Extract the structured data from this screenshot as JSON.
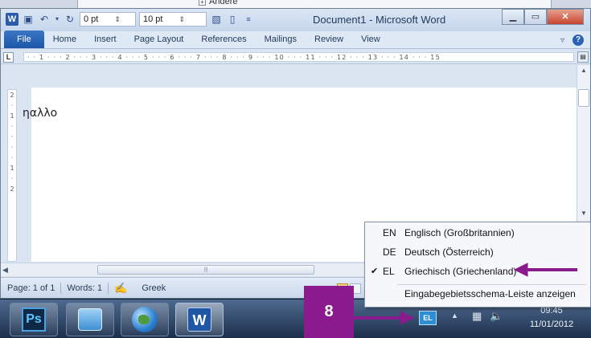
{
  "background_window": {
    "item_label": "Andere"
  },
  "titlebar": {
    "title": "Document1 - Microsoft Word",
    "app_icon": "W",
    "spacing_before": "0 pt",
    "spacing_after": "10 pt"
  },
  "ribbon_tabs": [
    "File",
    "Home",
    "Insert",
    "Page Layout",
    "References",
    "Mailings",
    "Review",
    "View"
  ],
  "ruler": {
    "corner": "L",
    "marks": "· · 1 · · · 2 · · · 3 · · · 4 · · · 5 · · · 6 · · · 7 · · · 8 · · · 9 · · · 10 · · · 11 · · · 12 · · · 13 · · · 14 · · · 15",
    "vertical_marks": [
      "2",
      "·",
      "1",
      "·",
      "·",
      "·",
      "·",
      "1",
      "·",
      "2"
    ]
  },
  "document": {
    "text": "ηαλλο"
  },
  "statusbar": {
    "page": "Page: 1 of 1",
    "words": "Words: 1",
    "language": "Greek"
  },
  "language_menu": {
    "items": [
      {
        "code": "EN",
        "name": "Englisch (Großbritannien)",
        "checked": false
      },
      {
        "code": "DE",
        "name": "Deutsch (Österreich)",
        "checked": false
      },
      {
        "code": "EL",
        "name": "Griechisch (Griechenland)",
        "checked": true
      }
    ],
    "show_bar": "Eingabegebietsschema-Leiste anzeigen",
    "check_glyph": "✔"
  },
  "taskbar": {
    "apps": [
      "Photoshop",
      "Control Panel",
      "Internet",
      "Microsoft Word"
    ],
    "ps_label": "Ps",
    "word_label": "W",
    "lang_indicator": "EL",
    "time": "09:45",
    "date": "11/01/2012"
  },
  "annotation": {
    "step": "8",
    "color": "#8b1a8f"
  }
}
